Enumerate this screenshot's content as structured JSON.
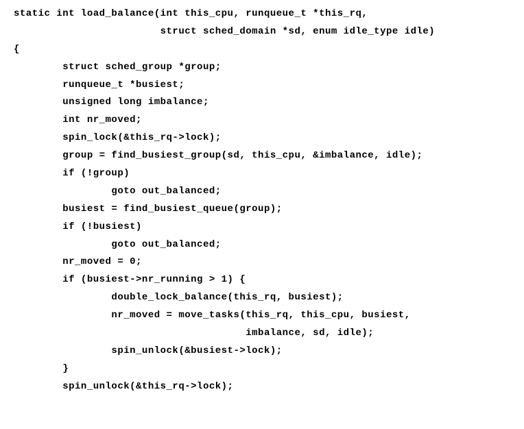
{
  "code": {
    "l1": "static int load_balance(int this_cpu, runqueue_t *this_rq,",
    "l2": "                        struct sched_domain *sd, enum idle_type idle)",
    "l3": "{",
    "l4": "        struct sched_group *group;",
    "l5": "        runqueue_t *busiest;",
    "l6": "        unsigned long imbalance;",
    "l7": "        int nr_moved;",
    "l8": "",
    "l9": "        spin_lock(&this_rq->lock);",
    "l10": "",
    "l11": "        group = find_busiest_group(sd, this_cpu, &imbalance, idle);",
    "l12": "        if (!group)",
    "l13": "                goto out_balanced;",
    "l14": "",
    "l15": "        busiest = find_busiest_queue(group);",
    "l16": "        if (!busiest)",
    "l17": "                goto out_balanced;",
    "l18": "",
    "l19": "        nr_moved = 0;",
    "l20": "        if (busiest->nr_running > 1) {",
    "l21": "                double_lock_balance(this_rq, busiest);",
    "l22": "                nr_moved = move_tasks(this_rq, this_cpu, busiest,",
    "l23": "                                      imbalance, sd, idle);",
    "l24": "                spin_unlock(&busiest->lock);",
    "l25": "        }",
    "l26": "        spin_unlock(&this_rq->lock);"
  }
}
